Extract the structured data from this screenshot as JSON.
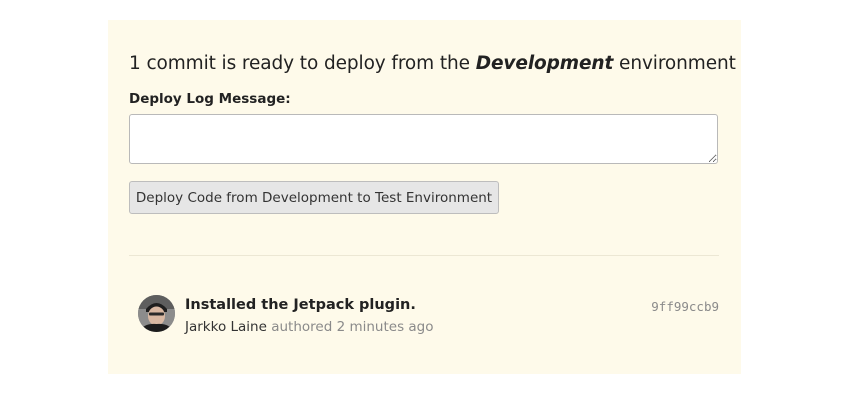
{
  "deploy": {
    "heading_prefix": "1 commit is ready to deploy from the",
    "heading_env": "Development",
    "heading_suffix": "environment",
    "log_label": "Deploy Log Message:",
    "log_value": "",
    "button_label": "Deploy Code from Development to Test Environment"
  },
  "commits": [
    {
      "message": "Installed the Jetpack plugin.",
      "author": "Jarkko Laine",
      "authored_text": "authored 2 minutes ago",
      "hash": "9ff99ccb9",
      "avatar_icon": "user-avatar"
    }
  ],
  "colors": {
    "panel_background": "#fefaea",
    "button_background": "#e6e6e6",
    "muted_text": "#8a8a8a"
  }
}
